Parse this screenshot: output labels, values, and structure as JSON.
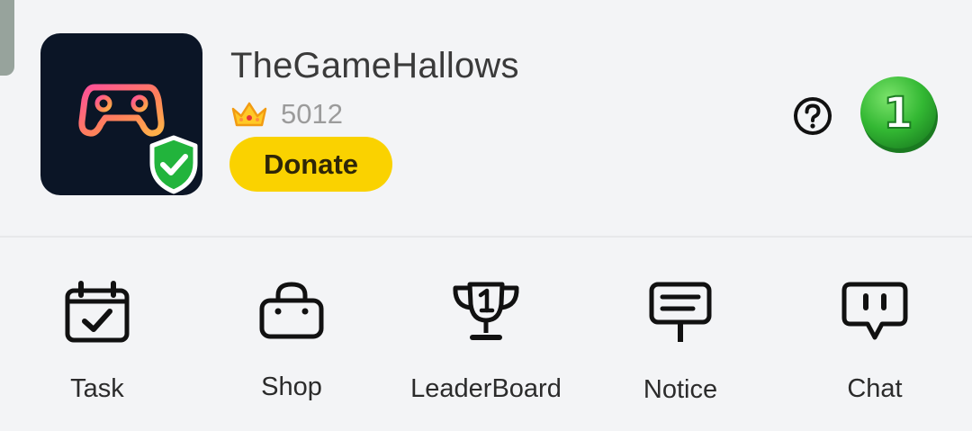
{
  "profile": {
    "name": "TheGameHallows",
    "score": "5012",
    "donate_label": "Donate",
    "level": "1"
  },
  "icons": {
    "avatar": "gamepad-icon",
    "verified": "shield-check-icon",
    "rank": "crown-icon",
    "help": "question-circle-icon",
    "level_badge": "number-badge"
  },
  "colors": {
    "background": "#f3f4f6",
    "donate": "#fad200",
    "avatar_bg": "#0b1526",
    "verified": "#22b43c",
    "level_badge": "#33b833"
  },
  "nav": {
    "items": [
      {
        "label": "Task",
        "icon": "calendar-check-icon"
      },
      {
        "label": "Shop",
        "icon": "shopping-bag-icon"
      },
      {
        "label": "LeaderBoard",
        "icon": "trophy-icon"
      },
      {
        "label": "Notice",
        "icon": "notice-board-icon"
      },
      {
        "label": "Chat",
        "icon": "chat-bubble-icon"
      }
    ]
  }
}
